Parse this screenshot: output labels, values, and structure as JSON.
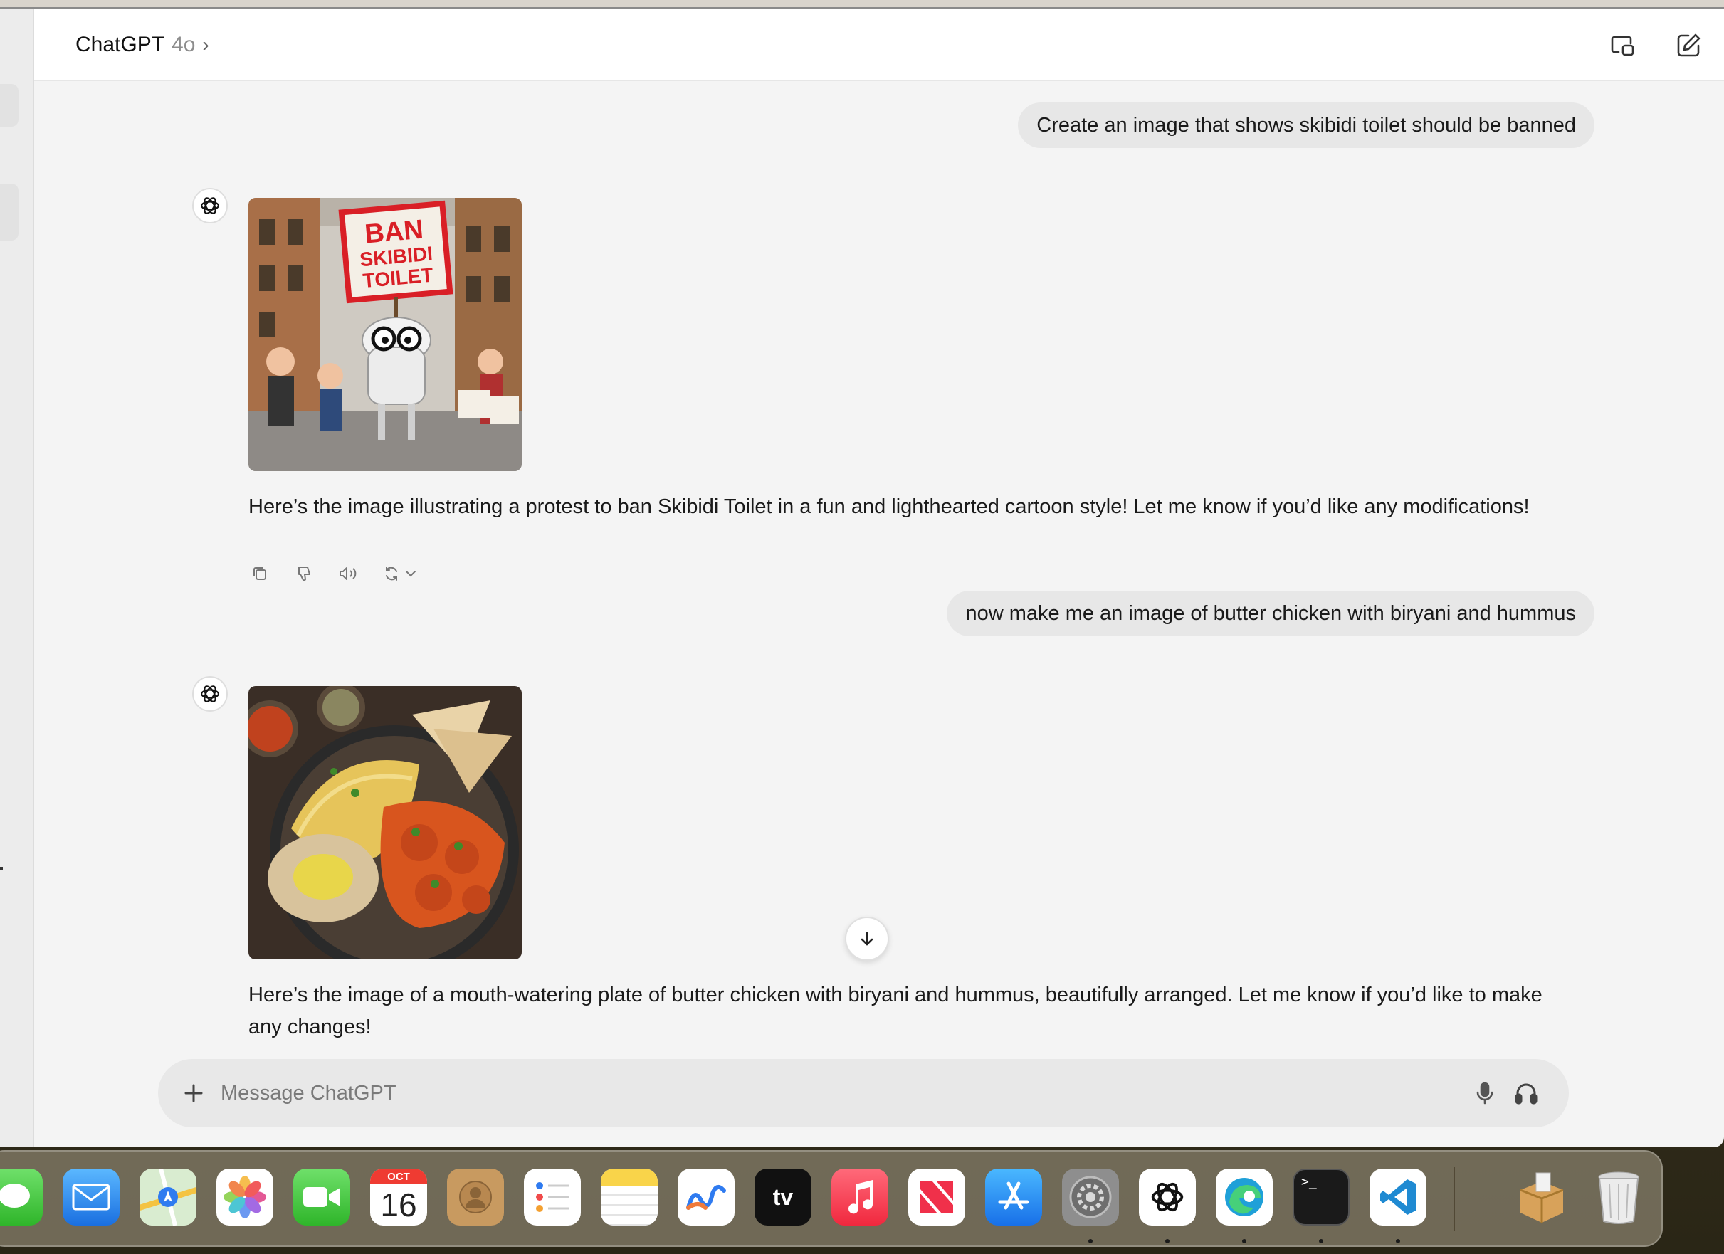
{
  "header": {
    "app_name": "ChatGPT",
    "model": "4o",
    "chevron": "›",
    "icons": [
      "new-window-icon",
      "new-chat-icon"
    ]
  },
  "messages": [
    {
      "role": "user",
      "text": "Create an image that shows skibidi toilet should be banned"
    },
    {
      "role": "assistant",
      "image": {
        "sign_text": "BAN SKIBIDI TOILET"
      },
      "text": "Here’s the image illustrating a protest to ban Skibidi Toilet in a fun and lighthearted cartoon style! Let me know if you’d like any modifications!"
    },
    {
      "role": "user",
      "text": "now make me an image of butter chicken with biryani and hummus"
    },
    {
      "role": "assistant",
      "image": {
        "subject": "butter-chicken-plate"
      },
      "text": "Here’s the image of a mouth-watering plate of butter chicken with biryani and hummus, beautifully arranged. Let me know if you’d like to make any changes!"
    }
  ],
  "message_actions": [
    "copy-icon",
    "thumbs-down-icon",
    "read-aloud-icon",
    "regenerate-icon",
    "chevron-down-icon"
  ],
  "composer": {
    "placeholder": "Message ChatGPT"
  },
  "calendar": {
    "month": "OCT",
    "day": "16"
  },
  "colors": {
    "user_bubble": "#e7e7e7",
    "window_bg": "#f4f4f4",
    "header_bg": "#ffffff"
  },
  "dock": [
    "messages",
    "mail",
    "maps",
    "photos",
    "facetime",
    "calendar",
    "contacts",
    "reminders",
    "notes",
    "freeform",
    "apple-tv",
    "music",
    "news",
    "app-store",
    "system-settings",
    "chatgpt",
    "edge",
    "terminal",
    "vscode",
    "archive-utility",
    "trash"
  ],
  "dock_labels": {
    "tv": "tv",
    "terminal_prompt": ">_"
  }
}
